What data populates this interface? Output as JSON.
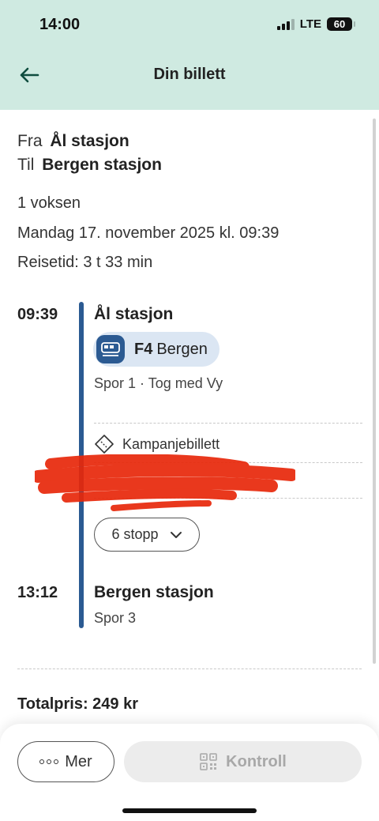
{
  "status_bar": {
    "time": "14:00",
    "network": "LTE",
    "battery": "60"
  },
  "header": {
    "title": "Din billett",
    "back_icon": "arrow-left-icon"
  },
  "route": {
    "from_label": "Fra",
    "from_value": "Ål stasjon",
    "to_label": "Til",
    "to_value": "Bergen stasjon"
  },
  "trip": {
    "passengers": "1 voksen",
    "date": "Mandag 17. november 2025 kl. 09:39",
    "duration": "Reisetid: 3 t 33 min"
  },
  "departure": {
    "time": "09:39",
    "station": "Ål stasjon",
    "line_code": "F4",
    "line_destination": "Bergen",
    "platform_info": "Spor 1 · Tog med Vy",
    "ticket_type": "Kampanjebillett",
    "stops_label": "6 stopp"
  },
  "arrival": {
    "time": "13:12",
    "station": "Bergen stasjon",
    "platform": "Spor 3"
  },
  "total_price": "Totalpris: 249 kr",
  "actions": {
    "more_label": "Mer",
    "control_label": "Kontroll"
  },
  "colors": {
    "header_bg": "#cfeae1",
    "timeline": "#2b5a92",
    "line_chip_bg": "#dbe6f3",
    "redaction": "#e8280a"
  }
}
